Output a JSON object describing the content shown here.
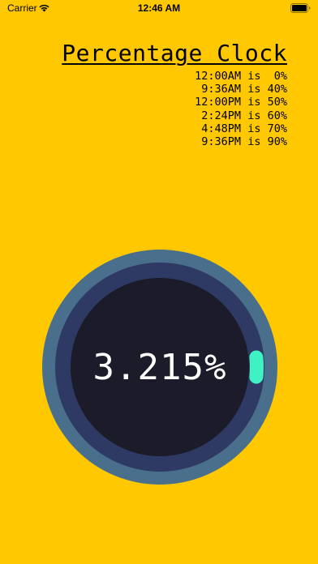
{
  "status_bar": {
    "carrier": "Carrier",
    "time": "12:46 AM",
    "icons": [
      "wifi-icon",
      "battery-icon"
    ]
  },
  "title": "Percentage Clock",
  "reference": [
    {
      "time": "12:00AM",
      "connector": "is",
      "percent": "0%"
    },
    {
      "time": "9:36AM",
      "connector": "is",
      "percent": "40%"
    },
    {
      "time": "12:00PM",
      "connector": "is",
      "percent": "50%"
    },
    {
      "time": "2:24PM",
      "connector": "is",
      "percent": "60%"
    },
    {
      "time": "4:48PM",
      "connector": "is",
      "percent": "70%"
    },
    {
      "time": "9:36PM",
      "connector": "is",
      "percent": "90%"
    }
  ],
  "clock": {
    "percent_text": "3.215%",
    "progress_fraction": 0.03215
  },
  "colors": {
    "background": "#FFC800",
    "outer_ring": "#4A6F8C",
    "middle_ring": "#2E3A63",
    "inner_face": "#1B1B2A",
    "progress": "#3FF2C4",
    "readout": "#FFFFFF"
  }
}
